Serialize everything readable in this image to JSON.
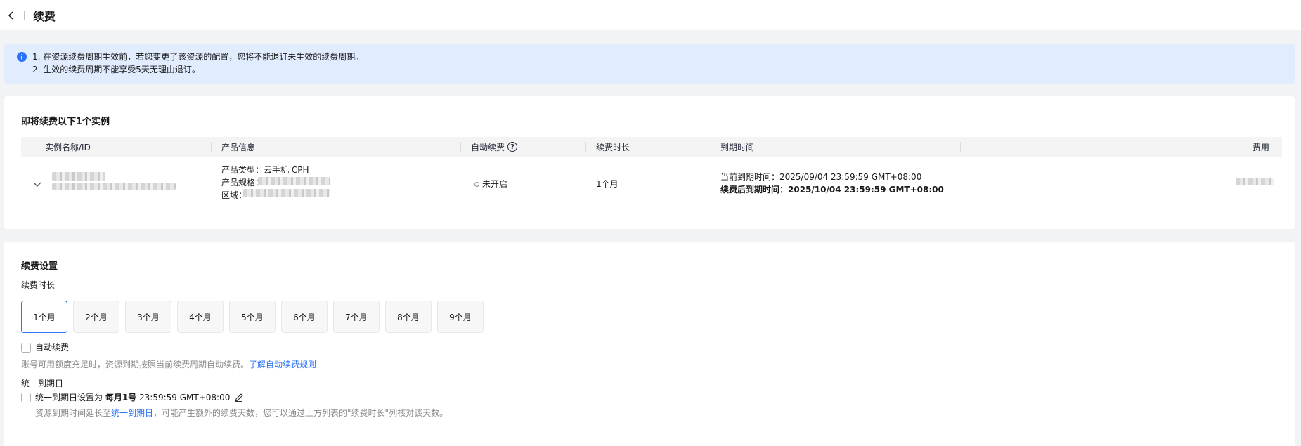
{
  "header": {
    "title": "续费"
  },
  "notice": {
    "lines": [
      "1. 在资源续费周期生效前，若您变更了该资源的配置，您将不能退订未生效的续费周期。",
      "2. 生效的续费周期不能享受5天无理由退订。"
    ]
  },
  "instances": {
    "title": "即将续费以下1个实例",
    "columns": {
      "name": "实例名称/ID",
      "product": "产品信息",
      "auto_renew": "自动续费",
      "duration": "续费时长",
      "expiry": "到期时间",
      "fee": "费用"
    },
    "rows": [
      {
        "product_type_label": "产品类型：",
        "product_type": "云手机 CPH",
        "spec_label": "产品规格：",
        "region_label": "区域：",
        "auto_renew_status": "未开启",
        "duration": "1个月",
        "current_expiry_label": "当前到期时间：",
        "current_expiry": "2025/09/04 23:59:59 GMT+08:00",
        "new_expiry_label": "续费后到期时间：",
        "new_expiry": "2025/10/04 23:59:59 GMT+08:00"
      }
    ]
  },
  "settings": {
    "title": "续费设置",
    "duration_label": "续费时长",
    "durations": [
      "1个月",
      "2个月",
      "3个月",
      "4个月",
      "5个月",
      "6个月",
      "7个月",
      "8个月",
      "9个月"
    ],
    "selected_duration": "1个月",
    "auto_renew_label": "自动续费",
    "auto_renew_hint": "账号可用额度充足时，资源到期按照当前续费周期自动续费。",
    "auto_renew_link": "了解自动续费规则",
    "unify_label": "统一到期日",
    "unify_prefix": "统一到期日设置为",
    "unify_day": "每月1号",
    "unify_time": "23:59:59 GMT+08:00",
    "unify_hint_prefix": "资源到期时间延长至",
    "unify_hint_link": "统一到期日",
    "unify_hint_suffix": "，可能产生额外的续费天数，您可以通过上方列表的\"续费时长\"列核对该天数。"
  },
  "colors": {
    "accent": "#2b73f7",
    "notice_bg": "#e1edff"
  }
}
